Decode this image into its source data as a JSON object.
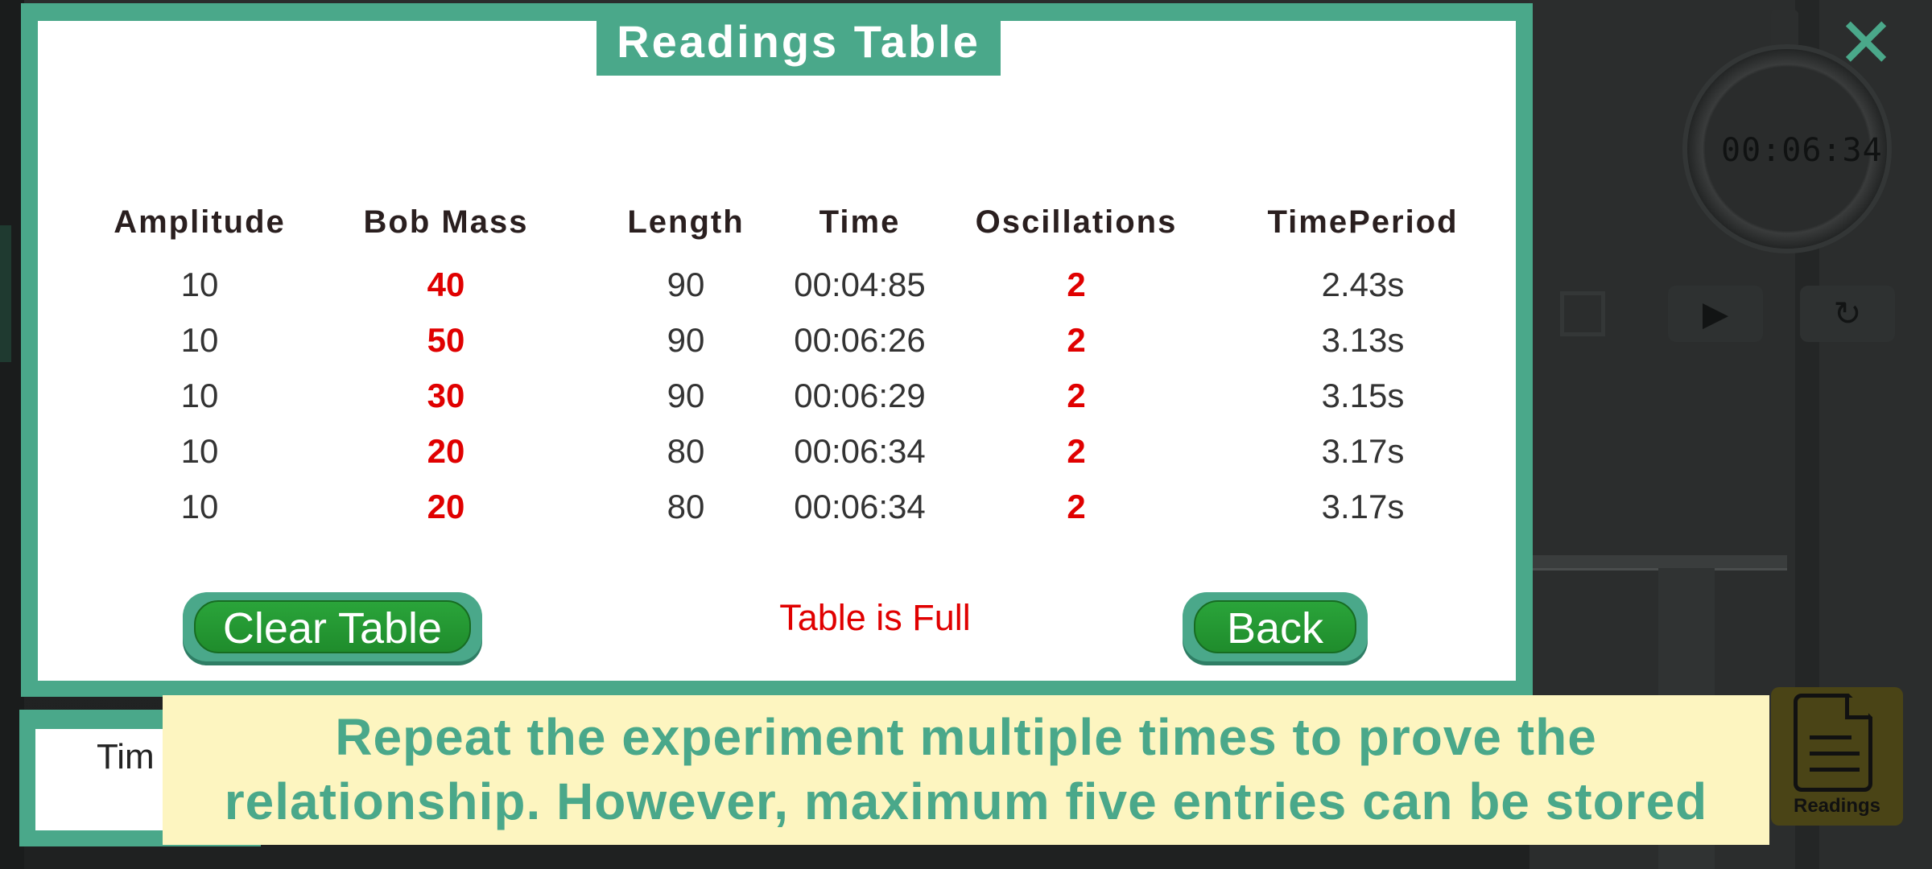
{
  "modal": {
    "title": "Readings Table",
    "columns": [
      "Amplitude",
      "Bob Mass",
      "Length",
      "Time",
      "Oscillations",
      "TimePeriod"
    ],
    "rows": [
      [
        "10",
        "40",
        "90",
        "00:04:85",
        "2",
        "2.43s"
      ],
      [
        "10",
        "50",
        "90",
        "00:06:26",
        "2",
        "3.13s"
      ],
      [
        "10",
        "30",
        "90",
        "00:06:29",
        "2",
        "3.15s"
      ],
      [
        "10",
        "20",
        "80",
        "00:06:34",
        "2",
        "3.17s"
      ],
      [
        "10",
        "20",
        "80",
        "00:06:34",
        "2",
        "3.17s"
      ]
    ],
    "status": "Table is Full",
    "clear_label": "Clear Table",
    "back_label": "Back"
  },
  "stopwatch": {
    "time": "00:06:34"
  },
  "lower_panel": {
    "text": "Tim"
  },
  "banner": {
    "line1": "Repeat the experiment multiple times to prove the",
    "line2": "relationship. However, maximum five entries can be stored"
  },
  "readings_button": {
    "label": "Readings"
  },
  "colors": {
    "accent": "#4aa88a",
    "highlight_red": "#e00000",
    "button_green": "#1f8c2c",
    "banner_bg": "#fdf5c0"
  },
  "icons": {
    "close": "close-icon",
    "play": "play-icon",
    "reset": "reset-icon",
    "readings": "document-icon"
  }
}
